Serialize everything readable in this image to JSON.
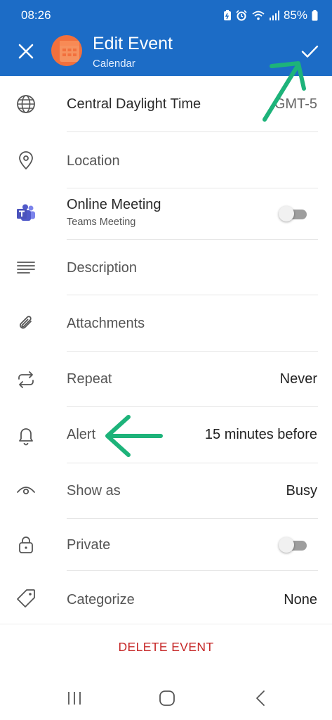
{
  "status_bar": {
    "time": "08:26",
    "battery": "85%"
  },
  "header": {
    "title": "Edit Event",
    "subtitle": "Calendar"
  },
  "rows": {
    "timezone": {
      "label": "Central Daylight Time",
      "value": "GMT-5"
    },
    "location": {
      "label": "Location"
    },
    "online_meeting": {
      "label": "Online Meeting",
      "sub": "Teams Meeting",
      "enabled": false
    },
    "description": {
      "label": "Description"
    },
    "attachments": {
      "label": "Attachments"
    },
    "repeat": {
      "label": "Repeat",
      "value": "Never"
    },
    "alert": {
      "label": "Alert",
      "value": "15 minutes before"
    },
    "show_as": {
      "label": "Show as",
      "value": "Busy"
    },
    "private": {
      "label": "Private",
      "enabled": false
    },
    "categorize": {
      "label": "Categorize",
      "value": "None"
    }
  },
  "delete_label": "DELETE EVENT",
  "colors": {
    "appbar": "#1c6cc6",
    "delete": "#c62828",
    "annotation_arrow": "#1db37a",
    "teams": "#5059c9"
  }
}
